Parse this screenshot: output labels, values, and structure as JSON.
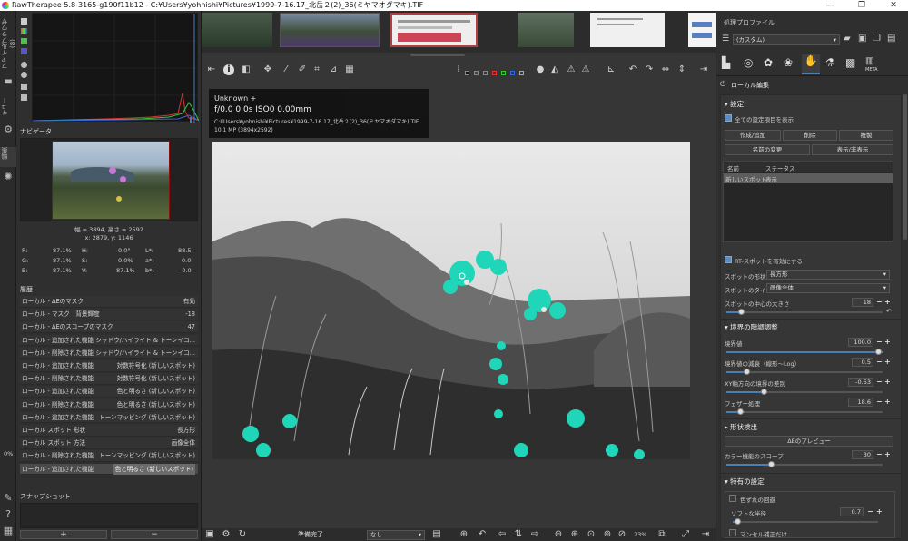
{
  "window": {
    "title": "RawTherapee 5.8-3165-g190f11b12 - C:¥Users¥yohnishi¥Pictures¥1999-7-16.17_北岳２(2)_36(ミヤマオダマキ).TIF",
    "min": "—",
    "max": "❐",
    "close": "✕"
  },
  "left_tabs": {
    "filebrowser": "ファイルブラウザ (8)",
    "queue": "キュー",
    "editor": "編集"
  },
  "navigator": {
    "title": "ナビゲータ",
    "size": "幅 = 3894, 高さ = 2592",
    "coords": "x: 2879, y: 1146",
    "r_label": "R:",
    "r": "87.1%",
    "g_label": "G:",
    "g": "87.1%",
    "b_label": "B:",
    "b": "87.1%",
    "h_label": "H:",
    "h": "0.0°",
    "s_label": "S:",
    "s": "0.0%",
    "v_label": "V:",
    "v": "87.1%",
    "l_label": "L*:",
    "l": "88.5",
    "a_label": "a*:",
    "a": "0.0",
    "bb_label": "b*:",
    "bb": "-0.0"
  },
  "history": {
    "title": "履歴",
    "rows": [
      {
        "action": "ローカル - ΔEのマスク",
        "value": "有効"
      },
      {
        "action": "ローカル - マスク　背景輝度",
        "value": "-18"
      },
      {
        "action": "ローカル - ΔEのスコープのマスク",
        "value": "47"
      },
      {
        "action": "ローカル - 追加された機能",
        "value": "シャドウ/ハイライト & トーンイコ..."
      },
      {
        "action": "ローカル - 削除された機能",
        "value": "シャドウ/ハイライト & トーンイコ..."
      },
      {
        "action": "ローカル - 追加された機能",
        "value": "対数符号化 (新しいスポット)"
      },
      {
        "action": "ローカル - 削除された機能",
        "value": "対数符号化 (新しいスポット)"
      },
      {
        "action": "ローカル - 追加された機能",
        "value": "色と明るさ (新しいスポット)"
      },
      {
        "action": "ローカル - 削除された機能",
        "value": "色と明るさ (新しいスポット)"
      },
      {
        "action": "ローカル - 追加された機能",
        "value": "トーンマッピング (新しいスポット)"
      },
      {
        "action": "ローカル スポット 形状",
        "value": "長方形"
      },
      {
        "action": "ローカル スポット 方法",
        "value": "画像全体"
      },
      {
        "action": "ローカル - 削除された機能",
        "value": "トーンマッピング (新しいスポット)"
      },
      {
        "action": "ローカル - 追加された機能",
        "value": "色と明るさ (新しいスポット)"
      }
    ],
    "percent": "0%"
  },
  "snapshot": {
    "title": "スナップショット",
    "add": "+",
    "remove": "−"
  },
  "image_info": {
    "camera": "Unknown +",
    "exposure": "f/0.0  0.0s  ISO0  0.00mm",
    "path": "C:¥Users¥yohnishi¥Pictures¥1999-7-16.17_北岳２(2)_36(ミヤマオダマキ).TIF",
    "megapixels": "10.1 MP (3894x2592)"
  },
  "bottom_bar": {
    "status": "準備完了",
    "profile": "なし",
    "zoom": "23%"
  },
  "right": {
    "profile_title": "処理プロファイル",
    "profile_value": "(カスタム)",
    "local_edit_title": "ローカル編集",
    "settings_title": "設定",
    "show_all": "全ての設定項目を表示",
    "btn_create": "作成/追加",
    "btn_delete": "削除",
    "btn_duplicate": "複製",
    "btn_rename": "名前の変更",
    "btn_showhide": "表示/非表示",
    "col_name": "名前",
    "col_status": "ステータス",
    "spot_name": "新しいスポット",
    "spot_status": "表示",
    "rt_spot": "RT-スポットを有効にする",
    "shape_label": "スポットの形状",
    "shape_value": "長方形",
    "type_label": "スポットのタイプ",
    "type_value": "画像全体",
    "center_label": "スポットの中心の大きさ",
    "center_value": "18",
    "gradient_title": "境界の階調調整",
    "boundary_label": "境界値",
    "boundary_value": "100.0",
    "decay_label": "境界値の減衰（線形～Log）",
    "decay_value": "0.5",
    "xy_label": "XY軸方向の境界の差別",
    "xy_value": "-0.53",
    "feather_label": "フェザー処理",
    "feather_value": "18.6",
    "shape_detect_title": "形状検出",
    "de_preview": "ΔEのプレビュー",
    "scope_label": "カラー機能のスコープ",
    "scope_value": "30",
    "special_title": "特有の設定",
    "shift_label": "色ずれの回避",
    "soft_label": "ソフトな半径",
    "soft_value": "0.7",
    "munsell_label": "マンセル補正だけ"
  },
  "colors": {
    "accent": "#4a7fb5",
    "cyan_flower": "#1fd6b8"
  }
}
